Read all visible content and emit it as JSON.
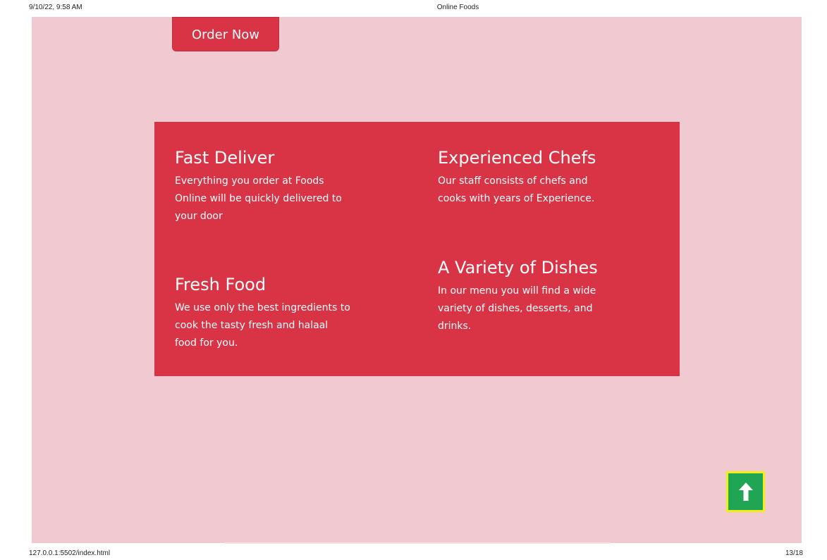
{
  "print_header": {
    "date": "9/10/22, 9:58 AM",
    "title": "Online Foods"
  },
  "print_footer": {
    "url": "127.0.0.1:5502/index.html",
    "page": "13/18"
  },
  "order_button": {
    "label": "Order Now"
  },
  "features": [
    {
      "title": "Fast Deliver",
      "text": "Everything you order at Foods Online will be quickly delivered to your door"
    },
    {
      "title": "Experienced Chefs",
      "text": "Our staff consists of chefs and cooks with years of Experience."
    },
    {
      "title": "Fresh Food",
      "text": "We use only the best ingredients to cook the tasty fresh and halaal food for you."
    },
    {
      "title": "A Variety of Dishes",
      "text": "In our menu you will find a wide variety of dishes, desserts, and drinks."
    }
  ],
  "scroll_top": {
    "icon": "arrow-up-icon"
  },
  "colors": {
    "page_background": "#f1c9d1",
    "accent_red": "#d93446",
    "scroll_button_green": "#1fa553",
    "scroll_button_border": "#f2ee13"
  }
}
